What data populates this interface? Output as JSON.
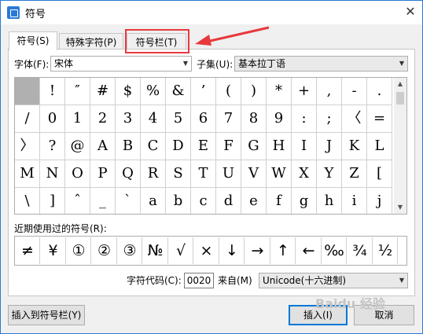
{
  "window": {
    "title": "符号",
    "close_glyph": "✕"
  },
  "tabs": [
    "符号(S)",
    "特殊字符(P)",
    "符号栏(T)"
  ],
  "font": {
    "label": "字体(F):",
    "value": "宋体"
  },
  "subset": {
    "label": "子集(U):",
    "value": "基本拉丁语"
  },
  "symbol_grid": [
    [
      "",
      "!",
      "″",
      "#",
      "$",
      "%",
      "&",
      "’",
      "(",
      ")",
      "*",
      "+",
      ",",
      "-",
      "."
    ],
    [
      "/",
      "0",
      "1",
      "2",
      "3",
      "4",
      "5",
      "6",
      "7",
      "8",
      "9",
      ":",
      ";",
      "〈",
      "="
    ],
    [
      "〉",
      "?",
      "@",
      "A",
      "B",
      "C",
      "D",
      "E",
      "F",
      "G",
      "H",
      "I",
      "J",
      "K",
      "L"
    ],
    [
      "M",
      "N",
      "O",
      "P",
      "Q",
      "R",
      "S",
      "T",
      "U",
      "V",
      "W",
      "X",
      "Y",
      "Z",
      "["
    ],
    [
      "\\",
      "]",
      "ˆ",
      "_",
      "`",
      "a",
      "b",
      "c",
      "d",
      "e",
      "f",
      "g",
      "h",
      "i",
      "j"
    ]
  ],
  "recent": {
    "label": "近期使用过的符号(R):",
    "symbols": [
      "≠",
      "¥",
      "①",
      "②",
      "③",
      "№",
      "√",
      "×",
      "↓",
      "→",
      "↑",
      "←",
      "‰",
      "¾",
      "½"
    ]
  },
  "char_code": {
    "label": "字符代码(C):",
    "value": "0020"
  },
  "from": {
    "label": "来自(M)",
    "value": "Unicode(十六进制)"
  },
  "buttons": {
    "insert_to_bar": "插入到符号栏(Y)",
    "insert": "插入(I)",
    "cancel": "取消"
  },
  "watermark": "Baidu 经验",
  "colors": {
    "accent": "#2b79d6",
    "annotation": "#e8393c",
    "selected_cell": "#b0b0b0"
  }
}
